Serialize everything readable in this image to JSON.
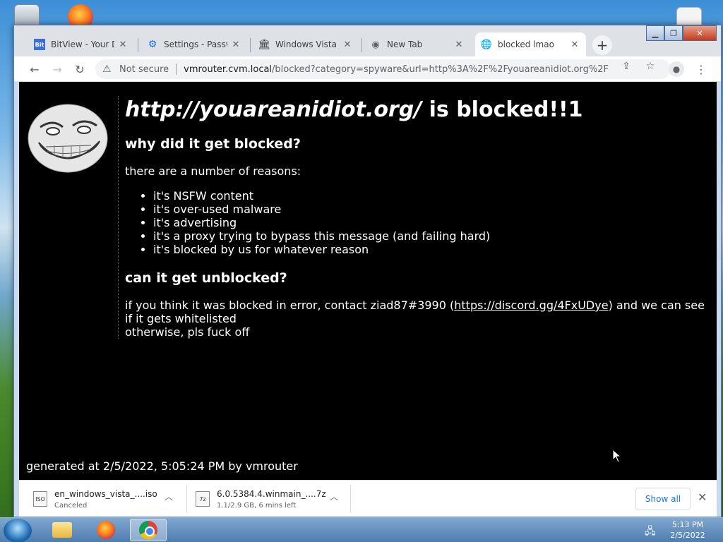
{
  "browser": {
    "tabs": [
      {
        "title": "BitView - Your Dig",
        "favicon": "bitview-icon",
        "active": false
      },
      {
        "title": "Settings - Passwo",
        "favicon": "gear-icon",
        "active": false
      },
      {
        "title": "Windows Vista wi",
        "favicon": "building-icon",
        "active": false
      },
      {
        "title": "New Tab",
        "favicon": "chrome-icon",
        "active": false
      },
      {
        "title": "blocked lmao",
        "favicon": "globe-icon",
        "active": true
      }
    ],
    "address": {
      "security_label": "Not secure",
      "host": "vmrouter.cvm.local",
      "path": "/blocked?category=spyware&url=http%3A%2F%2Fyouareanidiot.org%2F"
    }
  },
  "page": {
    "blocked_url": "http://youareanidiot.org/",
    "blocked_suffix": " is blocked!!1",
    "why_heading": "why did it get blocked?",
    "reasons_intro": "there are a number of reasons:",
    "reasons": [
      "it's NSFW content",
      "it's over-used malware",
      "it's advertising",
      "it's a proxy trying to bypass this message (and failing hard)",
      "it's blocked by us for whatever reason"
    ],
    "unblock_heading": "can it get unblocked?",
    "contact_prefix": "if you think it was blocked in error, contact ziad87#3990 (",
    "contact_link": "https://discord.gg/4FxUDye",
    "contact_suffix": ") and we can see if it gets whitelisted",
    "closing_line": "otherwise, pls fuck off",
    "generated_line": "generated at 2/5/2022, 5:05:24 PM by vmrouter"
  },
  "downloads": {
    "items": [
      {
        "name": "en_windows_vista_....iso",
        "status": "Canceled",
        "icon_label": "ISO"
      },
      {
        "name": "6.0.5384.4.winmain_....7z",
        "status": "1.1/2.9 GB, 6 mins left",
        "icon_label": "7z"
      }
    ],
    "show_all_label": "Show all"
  },
  "taskbar": {
    "time": "5:13 PM",
    "date": "2/5/2022"
  },
  "colors": {
    "page_background": "#000000",
    "page_text": "#ffffff",
    "accent_blue": "#1a73e8",
    "tabstrip": "#dee1e6"
  }
}
